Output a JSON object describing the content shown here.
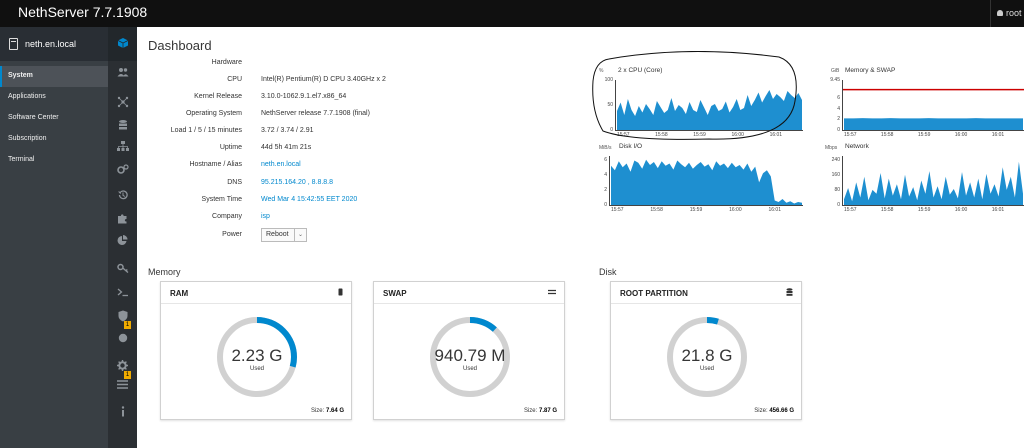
{
  "app": {
    "title": "NethServer 7.7.1908",
    "user": "root"
  },
  "sidebar": {
    "hostname": "neth.en.local",
    "items": [
      {
        "label": "System",
        "active": true
      },
      {
        "label": "Applications"
      },
      {
        "label": "Software Center"
      },
      {
        "label": "Subscription"
      },
      {
        "label": "Terminal"
      }
    ]
  },
  "iconbar": {
    "icons": [
      "dashboard-cube-icon",
      "users-icon",
      "network-icon",
      "storage-icon",
      "org-icon",
      "settings-gears-icon",
      "backup-history-icon",
      "puzzle-icon",
      "pie-chart-icon",
      "key-icon",
      "terminal-icon",
      "shield-icon",
      "circle-icon",
      "gear-icon",
      "list-icon",
      "info-icon"
    ],
    "badges": [
      {
        "label": "1"
      },
      {
        "label": "1"
      }
    ]
  },
  "dashboard": {
    "title": "Dashboard",
    "info": {
      "hardware_label": "Hardware",
      "hardware_value": "",
      "cpu_label": "CPU",
      "cpu_value": "Intel(R) Pentium(R) D CPU 3.40GHz x 2",
      "kernel_label": "Kernel Release",
      "kernel_value": "3.10.0-1062.9.1.el7.x86_64",
      "os_label": "Operating System",
      "os_value": "NethServer release 7.7.1908 (final)",
      "load_label": "Load 1 / 5 / 15 minutes",
      "load_value": "3.72 / 3.74 / 2.91",
      "uptime_label": "Uptime",
      "uptime_value": "44d 5h 41m 21s",
      "hostname_label": "Hostname / Alias",
      "hostname_value": "neth.en.local",
      "dns_label": "DNS",
      "dns_value": "95.215.164.20 , 8.8.8.8",
      "time_label": "System Time",
      "time_value": "Wed Mar 4 15:42:55 EET 2020",
      "company_label": "Company",
      "company_value": "isp",
      "power_label": "Power",
      "power_button": "Reboot"
    },
    "memory_title": "Memory",
    "disk_title": "Disk",
    "cards": {
      "ram": {
        "title": "RAM",
        "value": "2.23 G",
        "used": "Used",
        "size_label": "Size:",
        "size_value": "7.64 G",
        "fraction": 0.292
      },
      "swap": {
        "title": "SWAP",
        "value": "940.79 M",
        "used": "Used",
        "size_label": "Size:",
        "size_value": "7.87 G",
        "fraction": 0.117
      },
      "root": {
        "title": "ROOT PARTITION",
        "value": "21.8 G",
        "used": "Used",
        "size_label": "Size:",
        "size_value": "456.66 G",
        "fraction": 0.048
      }
    },
    "accent_color": "#0088ce",
    "track_color": "#d1d1d1"
  },
  "chart_data": [
    {
      "type": "area",
      "title": "2 x CPU (Core)",
      "ylabel": "%",
      "yticks": [
        "100",
        "50",
        "0"
      ],
      "ylim": [
        0,
        100
      ],
      "xticks": [
        "15:57",
        "15:58",
        "15:59",
        "16:00",
        "16:01"
      ],
      "color": "#1e8fd0",
      "values": [
        38,
        55,
        30,
        62,
        40,
        28,
        48,
        35,
        52,
        42,
        30,
        58,
        46,
        34,
        40,
        64,
        38,
        50,
        44,
        32,
        56,
        40,
        36,
        60,
        45,
        30,
        48,
        52,
        38,
        42,
        57,
        35,
        46,
        62,
        40,
        44,
        70,
        48,
        60,
        75,
        55,
        68,
        80,
        62,
        72,
        66,
        58,
        78,
        70,
        64,
        74,
        60
      ]
    },
    {
      "type": "area",
      "title": "Memory & SWAP",
      "ylabel": "GiB",
      "yticks": [
        "9.45",
        "6",
        "4",
        "2",
        "0"
      ],
      "ylim": [
        0,
        9.45
      ],
      "xticks": [
        "15:57",
        "15:58",
        "15:59",
        "16:00",
        "16:01"
      ],
      "color": "#1e8fd0",
      "limit_color": "#cc0000",
      "limit": 7.64,
      "values": [
        2.2,
        2.2,
        2.25,
        2.2,
        2.2,
        2.25,
        2.2,
        2.2,
        2.2,
        2.25,
        2.2,
        2.2,
        2.2,
        2.2,
        2.25,
        2.2,
        2.2,
        2.2,
        2.2,
        2.2
      ]
    },
    {
      "type": "area",
      "title": "Disk I/O",
      "ylabel": "MiB/s",
      "yticks": [
        "6",
        "4",
        "2",
        "0"
      ],
      "ylim": [
        0,
        6.5
      ],
      "xticks": [
        "15:57",
        "15:58",
        "15:59",
        "16:00",
        "16:01"
      ],
      "color": "#1e8fd0",
      "values": [
        5.2,
        4.6,
        5.8,
        5.0,
        5.5,
        4.4,
        5.9,
        5.6,
        4.8,
        6.0,
        5.3,
        5.7,
        4.9,
        5.8,
        5.2,
        5.5,
        4.7,
        5.9,
        5.4,
        5.0,
        5.6,
        4.8,
        5.3,
        5.7,
        5.1,
        5.4,
        4.6,
        5.8,
        5.2,
        5.5,
        4.9,
        5.6,
        5.0,
        5.3,
        4.7,
        5.5,
        4.4,
        5.1,
        3.0,
        4.2,
        4.6,
        3.8,
        0.6,
        0.4,
        0.8,
        0.3,
        0.5,
        0.2,
        0.4,
        0.3
      ]
    },
    {
      "type": "area",
      "title": "Network",
      "ylabel": "Mbps",
      "yticks": [
        "240",
        "160",
        "80",
        "0"
      ],
      "ylim": [
        0,
        260
      ],
      "xticks": [
        "15:57",
        "15:58",
        "15:59",
        "16:00",
        "16:01"
      ],
      "color": "#1e8fd0",
      "values": [
        30,
        90,
        20,
        120,
        40,
        150,
        25,
        80,
        60,
        170,
        35,
        140,
        50,
        110,
        30,
        160,
        45,
        95,
        25,
        130,
        60,
        180,
        40,
        100,
        30,
        150,
        55,
        85,
        35,
        175,
        50,
        120,
        40,
        140,
        30,
        165,
        60,
        110,
        45,
        200,
        80,
        150,
        40,
        230,
        60
      ]
    }
  ]
}
